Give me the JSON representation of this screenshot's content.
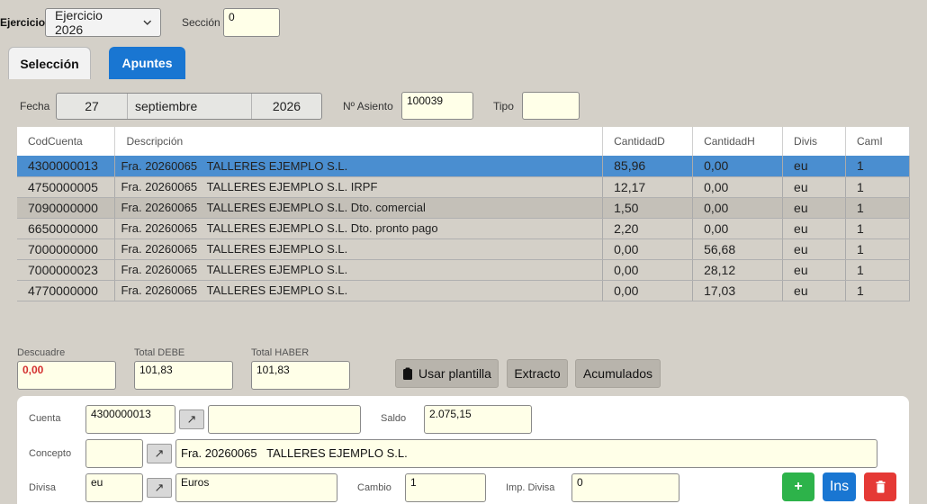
{
  "header": {
    "ejercicio_label": "Ejercicio",
    "ejercicio_value": "Ejercicio 2026",
    "seccion_label": "Sección",
    "seccion_value": "0"
  },
  "tabs": [
    {
      "label": "Selección"
    },
    {
      "label": "Apuntes"
    }
  ],
  "entry": {
    "fecha_label": "Fecha",
    "fecha_day": "27",
    "fecha_month": "septiembre",
    "fecha_year": "2026",
    "asiento_label": "Nº Asiento",
    "asiento_value": "100039",
    "tipo_label": "Tipo",
    "tipo_value": ""
  },
  "table": {
    "columns": [
      "CodCuenta",
      "Descripción",
      "CantidadD",
      "CantidadH",
      "Divis",
      "CamI"
    ],
    "rows": [
      [
        "4300000013",
        "Fra. 20260065   TALLERES EJEMPLO S.L.",
        "85,96",
        "0,00",
        "eu",
        "1"
      ],
      [
        "4750000005",
        "Fra. 20260065   TALLERES EJEMPLO S.L. IRPF",
        "12,17",
        "0,00",
        "eu",
        "1"
      ],
      [
        "7090000000",
        "Fra. 20260065   TALLERES EJEMPLO S.L. Dto. comercial",
        "1,50",
        "0,00",
        "eu",
        "1"
      ],
      [
        "6650000000",
        "Fra. 20260065   TALLERES EJEMPLO S.L. Dto. pronto pago",
        "2,20",
        "0,00",
        "eu",
        "1"
      ],
      [
        "7000000000",
        "Fra. 20260065   TALLERES EJEMPLO S.L.",
        "0,00",
        "56,68",
        "eu",
        "1"
      ],
      [
        "7000000023",
        "Fra. 20260065   TALLERES EJEMPLO S.L.",
        "0,00",
        "28,12",
        "eu",
        "1"
      ],
      [
        "4770000000",
        "Fra. 20260065   TALLERES EJEMPLO S.L.",
        "0,00",
        "17,03",
        "eu",
        "1"
      ]
    ]
  },
  "totals": {
    "descuadre_label": "Descuadre",
    "descuadre_value": "0,00",
    "debe_label": "Total DEBE",
    "debe_value": "101,83",
    "haber_label": "Total HABER",
    "haber_value": "101,83"
  },
  "actions": {
    "plantilla_label": "Usar plantilla",
    "extracto_label": "Extracto",
    "acumulados_label": "Acumulados"
  },
  "detail": {
    "cuenta_label": "Cuenta",
    "cuenta_value": "4300000013",
    "cuenta_name": "",
    "saldo_label": "Saldo",
    "saldo_value": "2.075,15",
    "concepto_label": "Concepto",
    "concepto_code": "",
    "concepto_text": "Fra. 20260065   TALLERES EJEMPLO S.L.",
    "divisa_label": "Divisa",
    "divisa_code": "eu",
    "divisa_name": "Euros",
    "cambio_label": "Cambio",
    "cambio_value": "1",
    "impdivisa_label": "Imp. Divisa",
    "impdivisa_value": "0",
    "add_label": "+",
    "ins_label": "Ins",
    "link_glyph": "↗"
  },
  "colors": {
    "accent": "#1976d2",
    "selected_row": "#4a8ed0",
    "add_green": "#2db34a",
    "delete_red": "#e53935",
    "field_bg": "#ffffe8"
  }
}
